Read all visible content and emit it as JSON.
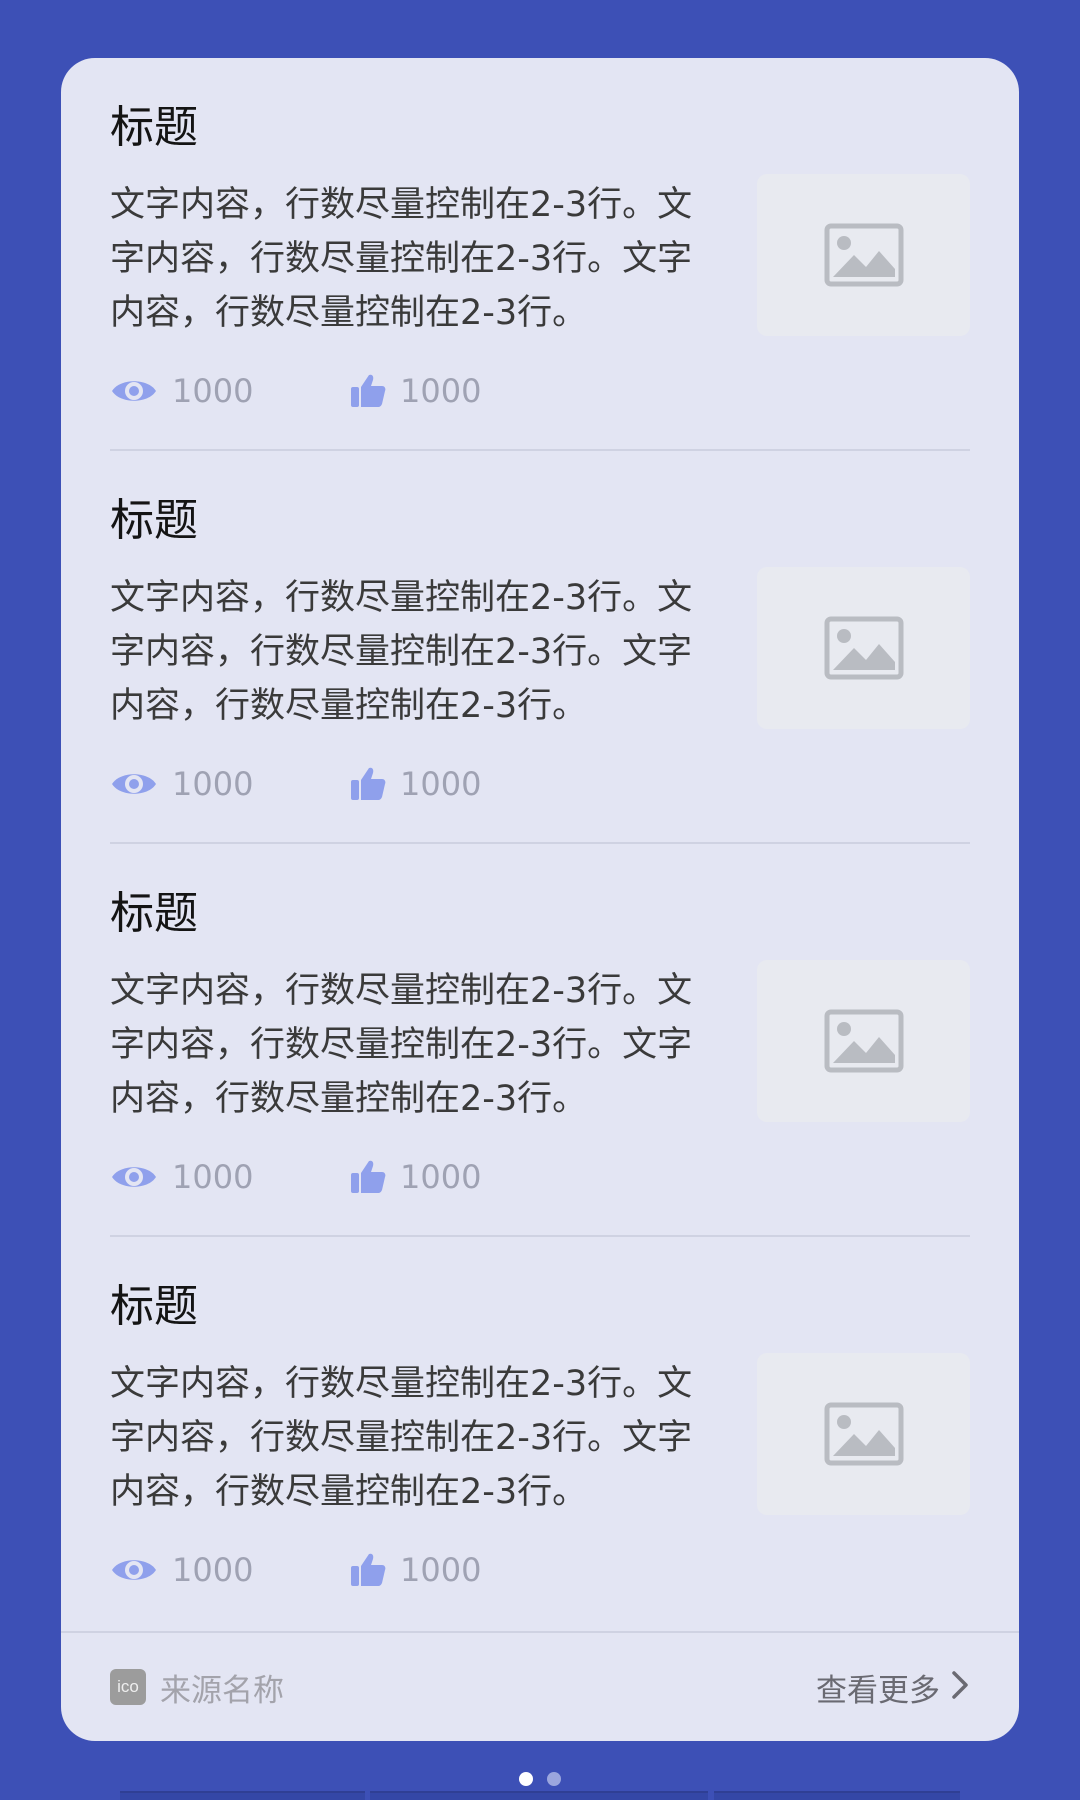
{
  "colors": {
    "background": "#3d50b6",
    "card": "#e3e5f3",
    "accent_icon": "#8fa0ec",
    "placeholder_icon": "#b9bcc2"
  },
  "items": [
    {
      "title": "标题",
      "description": "文字内容，行数尽量控制在2-3行。文字内容，行数尽量控制在2-3行。文字内容，行数尽量控制在2-3行。",
      "views": "1000",
      "likes": "1000",
      "thumbnail_icon": "image-placeholder-icon"
    },
    {
      "title": "标题",
      "description": "文字内容，行数尽量控制在2-3行。文字内容，行数尽量控制在2-3行。文字内容，行数尽量控制在2-3行。",
      "views": "1000",
      "likes": "1000",
      "thumbnail_icon": "image-placeholder-icon"
    },
    {
      "title": "标题",
      "description": "文字内容，行数尽量控制在2-3行。文字内容，行数尽量控制在2-3行。文字内容，行数尽量控制在2-3行。",
      "views": "1000",
      "likes": "1000",
      "thumbnail_icon": "image-placeholder-icon"
    },
    {
      "title": "标题",
      "description": "文字内容，行数尽量控制在2-3行。文字内容，行数尽量控制在2-3行。文字内容，行数尽量控制在2-3行。",
      "views": "1000",
      "likes": "1000",
      "thumbnail_icon": "image-placeholder-icon"
    }
  ],
  "footer": {
    "source_badge": "ico",
    "source_name": "来源名称",
    "more_label": "查看更多"
  },
  "pagination": {
    "current_page": 1,
    "total_pages": 2
  }
}
